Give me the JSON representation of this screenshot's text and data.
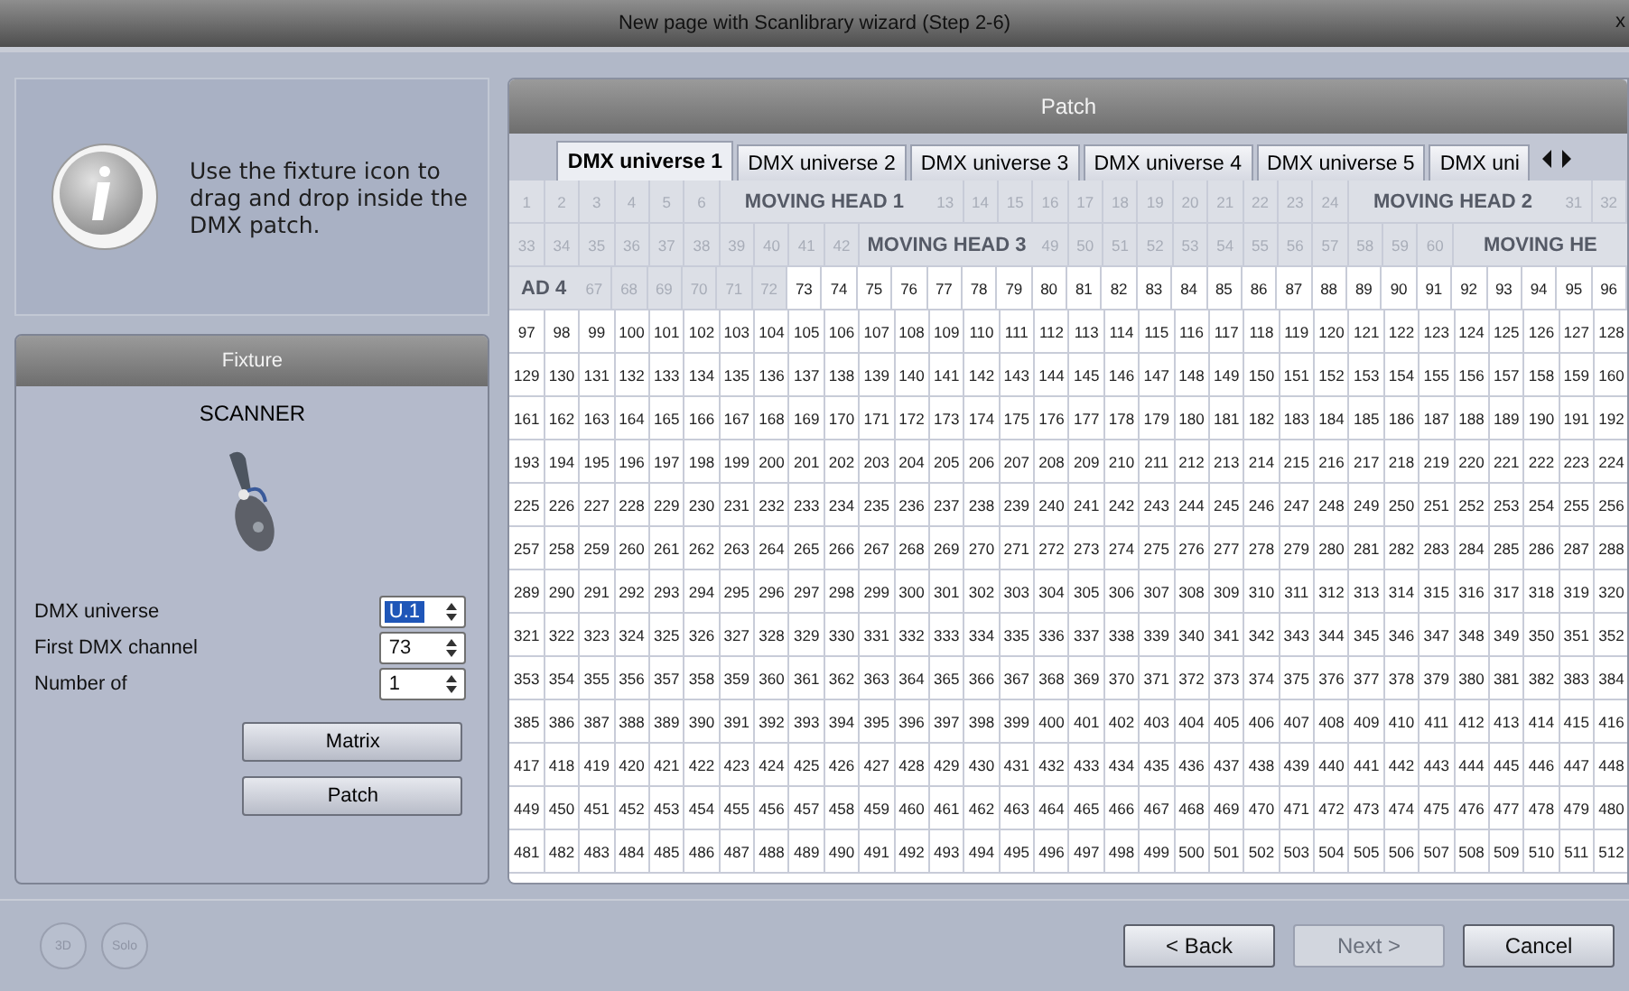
{
  "window": {
    "title": "New page with Scanlibrary wizard (Step 2-6)",
    "close": "x"
  },
  "info": {
    "text": "Use the fixture icon to drag and drop inside the DMX patch."
  },
  "fixture": {
    "title": "Fixture",
    "name": "SCANNER",
    "fields": [
      {
        "label": "DMX universe",
        "value": "U.1",
        "highlighted": true
      },
      {
        "label": "First DMX channel",
        "value": "73",
        "highlighted": false
      },
      {
        "label": "Number of",
        "value": "1",
        "highlighted": false
      }
    ],
    "buttons": [
      "Matrix",
      "Patch"
    ]
  },
  "patch": {
    "title": "Patch",
    "tabs": [
      {
        "label": "DMX universe 1",
        "selected": true
      },
      {
        "label": "DMX universe 2",
        "selected": false
      },
      {
        "label": "DMX universe 3",
        "selected": false
      },
      {
        "label": "DMX universe 4",
        "selected": false
      },
      {
        "label": "DMX universe 5",
        "selected": false
      },
      {
        "label": "DMX uni",
        "selected": false
      }
    ],
    "rows": [
      {
        "patched": [
          {
            "kind": "channel",
            "text": "1"
          },
          {
            "kind": "channel",
            "text": "2"
          },
          {
            "kind": "channel",
            "text": "3"
          },
          {
            "kind": "channel",
            "text": "4"
          },
          {
            "kind": "channel",
            "text": "5"
          },
          {
            "kind": "channel",
            "text": "6"
          },
          {
            "kind": "label",
            "text": "MOVING HEAD 1"
          },
          {
            "kind": "channel",
            "text": "13"
          },
          {
            "kind": "channel",
            "text": "14"
          },
          {
            "kind": "channel",
            "text": "15"
          },
          {
            "kind": "channel",
            "text": "16"
          },
          {
            "kind": "channel",
            "text": "17"
          },
          {
            "kind": "channel",
            "text": "18"
          },
          {
            "kind": "channel",
            "text": "19"
          },
          {
            "kind": "channel",
            "text": "20"
          },
          {
            "kind": "channel",
            "text": "21"
          },
          {
            "kind": "channel",
            "text": "22"
          },
          {
            "kind": "channel",
            "text": "23"
          },
          {
            "kind": "channel",
            "text": "24"
          },
          {
            "kind": "label",
            "text": "MOVING HEAD 2"
          },
          {
            "kind": "channel",
            "text": "31"
          },
          {
            "kind": "channel",
            "text": "32"
          }
        ],
        "free": []
      },
      {
        "patched": [
          {
            "kind": "channel",
            "text": "33"
          },
          {
            "kind": "channel",
            "text": "34"
          },
          {
            "kind": "channel",
            "text": "35"
          },
          {
            "kind": "channel",
            "text": "36"
          },
          {
            "kind": "channel",
            "text": "37"
          },
          {
            "kind": "channel",
            "text": "38"
          },
          {
            "kind": "channel",
            "text": "39"
          },
          {
            "kind": "channel",
            "text": "40"
          },
          {
            "kind": "channel",
            "text": "41"
          },
          {
            "kind": "channel",
            "text": "42"
          },
          {
            "kind": "label",
            "text": "MOVING HEAD 3"
          },
          {
            "kind": "channel",
            "text": "49"
          },
          {
            "kind": "channel",
            "text": "50"
          },
          {
            "kind": "channel",
            "text": "51"
          },
          {
            "kind": "channel",
            "text": "52"
          },
          {
            "kind": "channel",
            "text": "53"
          },
          {
            "kind": "channel",
            "text": "54"
          },
          {
            "kind": "channel",
            "text": "55"
          },
          {
            "kind": "channel",
            "text": "56"
          },
          {
            "kind": "channel",
            "text": "57"
          },
          {
            "kind": "channel",
            "text": "58"
          },
          {
            "kind": "channel",
            "text": "59"
          },
          {
            "kind": "channel",
            "text": "60"
          },
          {
            "kind": "label",
            "text": "MOVING HE"
          }
        ],
        "free": []
      },
      {
        "patched": [
          {
            "kind": "label",
            "text": "AD 4"
          },
          {
            "kind": "channel",
            "text": "67"
          },
          {
            "kind": "channel",
            "text": "68"
          },
          {
            "kind": "channel",
            "text": "69"
          },
          {
            "kind": "channel",
            "text": "70"
          },
          {
            "kind": "channel",
            "text": "71"
          },
          {
            "kind": "channel",
            "text": "72"
          }
        ],
        "free": [
          "73",
          "74",
          "75",
          "76",
          "77",
          "78",
          "79",
          "80",
          "81",
          "82",
          "83",
          "84",
          "85",
          "86",
          "87",
          "88",
          "89",
          "90",
          "91",
          "92",
          "93",
          "94",
          "95",
          "96"
        ]
      },
      {
        "patched": [],
        "free": [
          "97",
          "98",
          "99",
          "100",
          "101",
          "102",
          "103",
          "104",
          "105",
          "106",
          "107",
          "108",
          "109",
          "110",
          "111",
          "112",
          "113",
          "114",
          "115",
          "116",
          "117",
          "118",
          "119",
          "120",
          "121",
          "122",
          "123",
          "124",
          "125",
          "126",
          "127",
          "128"
        ]
      },
      {
        "patched": [],
        "free": [
          "129",
          "130",
          "131",
          "132",
          "133",
          "134",
          "135",
          "136",
          "137",
          "138",
          "139",
          "140",
          "141",
          "142",
          "143",
          "144",
          "145",
          "146",
          "147",
          "148",
          "149",
          "150",
          "151",
          "152",
          "153",
          "154",
          "155",
          "156",
          "157",
          "158",
          "159",
          "160"
        ]
      },
      {
        "patched": [],
        "free": [
          "161",
          "162",
          "163",
          "164",
          "165",
          "166",
          "167",
          "168",
          "169",
          "170",
          "171",
          "172",
          "173",
          "174",
          "175",
          "176",
          "177",
          "178",
          "179",
          "180",
          "181",
          "182",
          "183",
          "184",
          "185",
          "186",
          "187",
          "188",
          "189",
          "190",
          "191",
          "192"
        ]
      },
      {
        "patched": [],
        "free": [
          "193",
          "194",
          "195",
          "196",
          "197",
          "198",
          "199",
          "200",
          "201",
          "202",
          "203",
          "204",
          "205",
          "206",
          "207",
          "208",
          "209",
          "210",
          "211",
          "212",
          "213",
          "214",
          "215",
          "216",
          "217",
          "218",
          "219",
          "220",
          "221",
          "222",
          "223",
          "224"
        ]
      },
      {
        "patched": [],
        "free": [
          "225",
          "226",
          "227",
          "228",
          "229",
          "230",
          "231",
          "232",
          "233",
          "234",
          "235",
          "236",
          "237",
          "238",
          "239",
          "240",
          "241",
          "242",
          "243",
          "244",
          "245",
          "246",
          "247",
          "248",
          "249",
          "250",
          "251",
          "252",
          "253",
          "254",
          "255",
          "256"
        ]
      },
      {
        "patched": [],
        "free": [
          "257",
          "258",
          "259",
          "260",
          "261",
          "262",
          "263",
          "264",
          "265",
          "266",
          "267",
          "268",
          "269",
          "270",
          "271",
          "272",
          "273",
          "274",
          "275",
          "276",
          "277",
          "278",
          "279",
          "280",
          "281",
          "282",
          "283",
          "284",
          "285",
          "286",
          "287",
          "288"
        ]
      },
      {
        "patched": [],
        "free": [
          "289",
          "290",
          "291",
          "292",
          "293",
          "294",
          "295",
          "296",
          "297",
          "298",
          "299",
          "300",
          "301",
          "302",
          "303",
          "304",
          "305",
          "306",
          "307",
          "308",
          "309",
          "310",
          "311",
          "312",
          "313",
          "314",
          "315",
          "316",
          "317",
          "318",
          "319",
          "320"
        ]
      },
      {
        "patched": [],
        "free": [
          "321",
          "322",
          "323",
          "324",
          "325",
          "326",
          "327",
          "328",
          "329",
          "330",
          "331",
          "332",
          "333",
          "334",
          "335",
          "336",
          "337",
          "338",
          "339",
          "340",
          "341",
          "342",
          "343",
          "344",
          "345",
          "346",
          "347",
          "348",
          "349",
          "350",
          "351",
          "352"
        ]
      },
      {
        "patched": [],
        "free": [
          "353",
          "354",
          "355",
          "356",
          "357",
          "358",
          "359",
          "360",
          "361",
          "362",
          "363",
          "364",
          "365",
          "366",
          "367",
          "368",
          "369",
          "370",
          "371",
          "372",
          "373",
          "374",
          "375",
          "376",
          "377",
          "378",
          "379",
          "380",
          "381",
          "382",
          "383",
          "384"
        ]
      },
      {
        "patched": [],
        "free": [
          "385",
          "386",
          "387",
          "388",
          "389",
          "390",
          "391",
          "392",
          "393",
          "394",
          "395",
          "396",
          "397",
          "398",
          "399",
          "400",
          "401",
          "402",
          "403",
          "404",
          "405",
          "406",
          "407",
          "408",
          "409",
          "410",
          "411",
          "412",
          "413",
          "414",
          "415",
          "416"
        ]
      },
      {
        "patched": [],
        "free": [
          "417",
          "418",
          "419",
          "420",
          "421",
          "422",
          "423",
          "424",
          "425",
          "426",
          "427",
          "428",
          "429",
          "430",
          "431",
          "432",
          "433",
          "434",
          "435",
          "436",
          "437",
          "438",
          "439",
          "440",
          "441",
          "442",
          "443",
          "444",
          "445",
          "446",
          "447",
          "448"
        ]
      },
      {
        "patched": [],
        "free": [
          "449",
          "450",
          "451",
          "452",
          "453",
          "454",
          "455",
          "456",
          "457",
          "458",
          "459",
          "460",
          "461",
          "462",
          "463",
          "464",
          "465",
          "466",
          "467",
          "468",
          "469",
          "470",
          "471",
          "472",
          "473",
          "474",
          "475",
          "476",
          "477",
          "478",
          "479",
          "480"
        ]
      },
      {
        "patched": [],
        "free": [
          "481",
          "482",
          "483",
          "484",
          "485",
          "486",
          "487",
          "488",
          "489",
          "490",
          "491",
          "492",
          "493",
          "494",
          "495",
          "496",
          "497",
          "498",
          "499",
          "500",
          "501",
          "502",
          "503",
          "504",
          "505",
          "506",
          "507",
          "508",
          "509",
          "510",
          "511",
          "512"
        ]
      }
    ]
  },
  "footer": {
    "toggles": [
      {
        "label": "3D",
        "disabled": true
      },
      {
        "label": "Solo",
        "disabled": true
      }
    ],
    "buttons": [
      {
        "label": "< Back",
        "disabled": false
      },
      {
        "label": "Next >",
        "disabled": true
      },
      {
        "label": "Cancel",
        "disabled": false
      }
    ]
  }
}
